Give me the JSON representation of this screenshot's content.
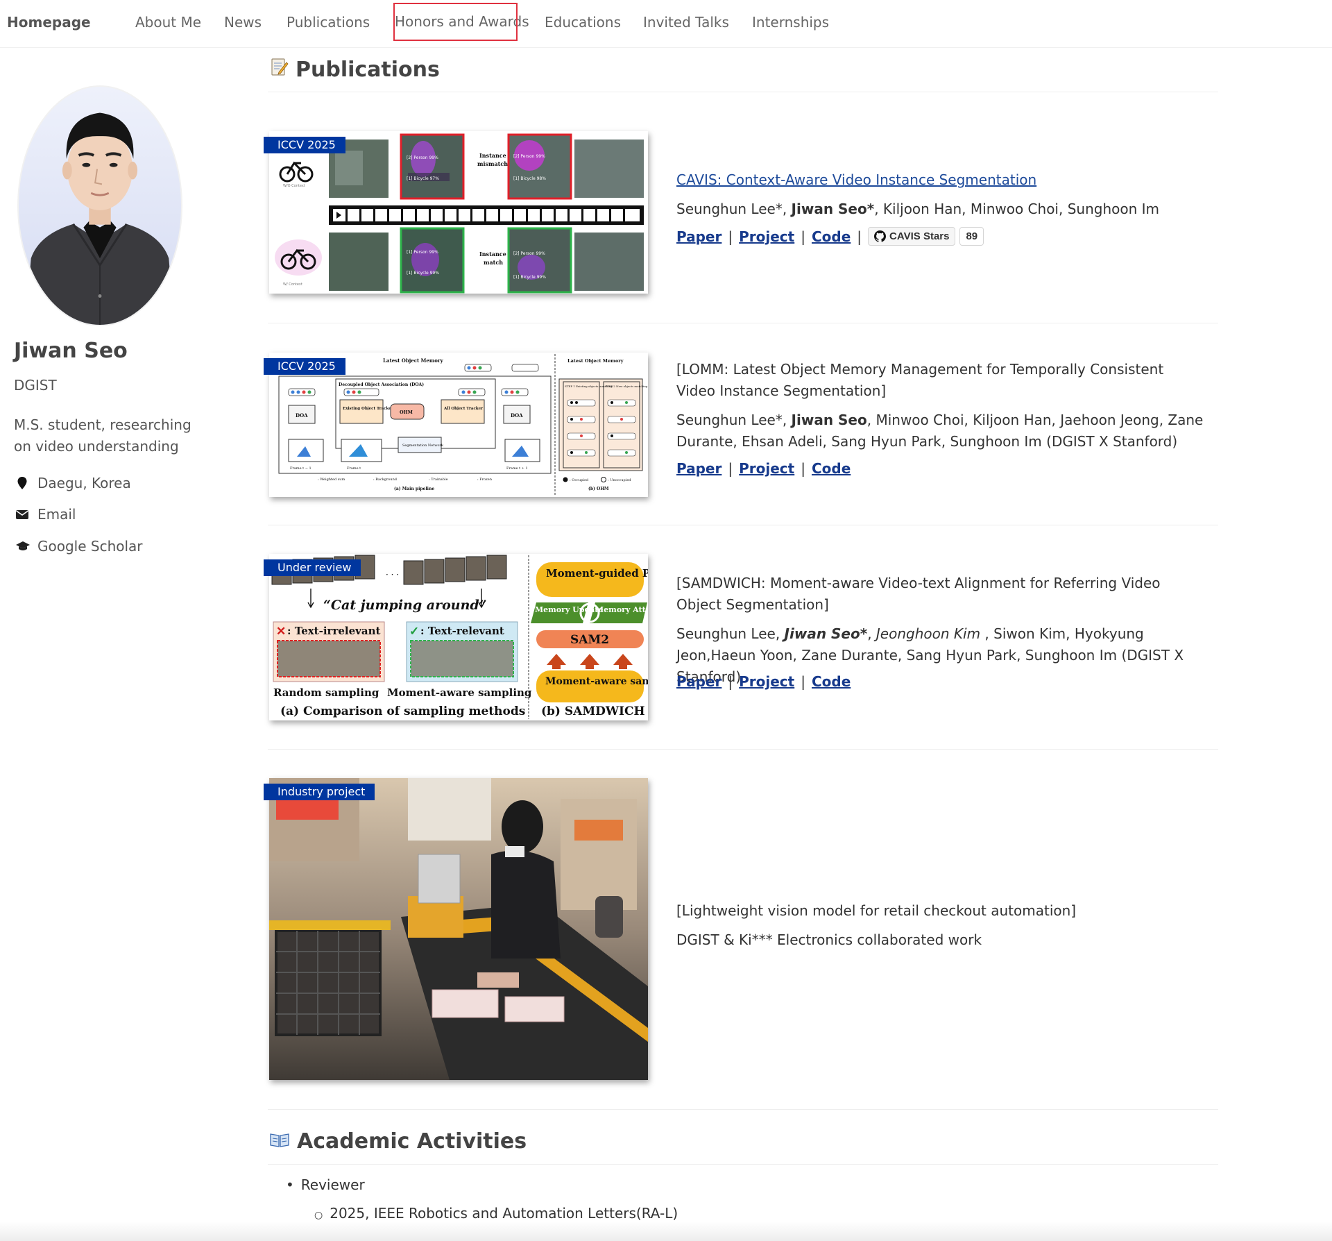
{
  "nav": {
    "brand": "Homepage",
    "items": [
      "About Me",
      "News",
      "Publications",
      "Honors and Awards",
      "Educations",
      "Invited Talks",
      "Internships"
    ]
  },
  "author": {
    "name": "Jiwan Seo",
    "affiliation": "DGIST",
    "bio": "M.S. student, researching on video understanding",
    "location": "Daegu, Korea",
    "email": "Email",
    "scholar": "Google Scholar"
  },
  "sections": {
    "publications": "Publications",
    "publications_icon": "memo-icon",
    "academic": "Academic Activities",
    "academic_icon": "book-icon"
  },
  "publications": [
    {
      "badge": "ICCV 2025",
      "title": "CAVIS: Context-Aware Video Instance Segmentation",
      "authors_pre": "Seunghun Lee*, ",
      "authors_bold": "Jiwan Seo*",
      "authors_post": ", Kiljoon Han, Minwoo Choi, Sunghoon Im",
      "links": [
        "Paper",
        "Project",
        "Code"
      ],
      "github": {
        "label": "CAVIS Stars",
        "count": "89"
      },
      "figure": {
        "left_caption": "W/O Context",
        "left_caption_2": "W/ Context",
        "mismatch": "Instance\nmismatch",
        "match": "Instance\nmatch",
        "labels": [
          "[2] Person 99%",
          "[1] Bicycle 97%",
          "[2] Person 99%",
          "[1] Bicycle 98%",
          "[1] Person 99%",
          "[1] Bicycle 99%",
          "[2] Person 99%",
          "[1] Bicycle 99%"
        ]
      }
    },
    {
      "badge": "ICCV 2025",
      "title": "[LOMM: Latest Object Memory Management for Temporally Consistent Video Instance Segmentation]",
      "authors_pre": "Seunghun Lee*, ",
      "authors_bold": "Jiwan Seo",
      "authors_post": ", Minwoo Choi, Kiljoon Han, Jaehoon Jeong, Zane Durante, Ehsan Adeli, Sang Hyun Park, Sunghoon Im (DGIST X Stanford)",
      "links": [
        "Paper",
        "Project",
        "Code"
      ],
      "figure": {
        "memory": "Latest Object Memory",
        "doa_box": "Decoupled Object Association (DOA)",
        "doa": "DOA",
        "existing": "Existing Object Tracker",
        "ohm": "OHM",
        "all": "All Object Tracker",
        "seg": "Segmentation Network",
        "frames": [
          "Frame t − 1",
          "Frame t",
          "Frame t + 1"
        ],
        "legend": [
          ": Weighted sum",
          ": Background",
          ": Trainable",
          ": Frozen",
          ": Occupied",
          ": Unoccupied"
        ],
        "cap_a": "(a) Main pipeline",
        "cap_b": "(b) OHM",
        "step1": "STEP 1 Existing objects matching",
        "step2": "STEP 2 New objects matching"
      }
    },
    {
      "badge": "Under review",
      "title": "[SAMDWICH: Moment-aware Video-text Alignment for Referring Video Object Segmentation]",
      "authors_html_parts": [
        {
          "t": "Seunghun Lee, ",
          "s": "n"
        },
        {
          "t": "Jiwan Seo*",
          "s": "bi"
        },
        {
          "t": ", ",
          "s": "n"
        },
        {
          "t": "Jeonghoon Kim",
          "s": "i"
        },
        {
          "t": " , Siwon Kim, Hyokyung Jeon,Haeun Yoon, Zane Durante, Sang Hyun Park, Sunghoon Im (DGIST X Stanford)",
          "s": "n"
        }
      ],
      "links": [
        "Paper",
        "Project",
        "Code"
      ],
      "figure": {
        "quote": "“Cat jumping around”",
        "irrelevant": ": Text-irrelevant",
        "relevant": ": Text-relevant",
        "random": "Random sampling",
        "moment": "Moment-aware sampling",
        "cap_a": "(a) Comparison of sampling methods",
        "guided": "Moment-guided Propagation",
        "mem_update": "Memory Update",
        "mem_attn": "Memory Attention",
        "sam2": "SAM2",
        "aware": "Moment-aware sampling",
        "cap_b": "(b) SAMDWICH"
      }
    },
    {
      "badge": "Industry project",
      "title": "[Lightweight vision model for retail checkout automation]",
      "subtitle": "DGIST & Ki*** Electronics collaborated work"
    }
  ],
  "academic": {
    "item": "Reviewer",
    "sub": "2025, IEEE Robotics and Automation Letters(RA-L)"
  },
  "colors": {
    "badge": "#00369f",
    "link": "#173a8c",
    "nav_highlight": "#e0313f"
  }
}
